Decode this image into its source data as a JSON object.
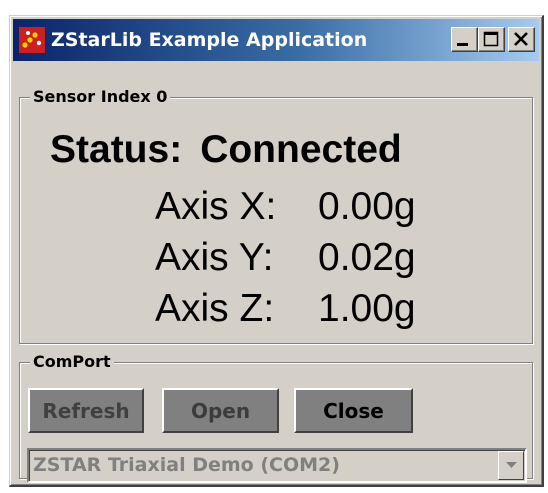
{
  "window": {
    "title": "ZStarLib Example Application",
    "icon": "zstar-app-icon",
    "controls": [
      "minimize-icon",
      "maximize-icon",
      "close-icon"
    ]
  },
  "sensor": {
    "group_label": "Sensor Index 0",
    "status_label": "Status:",
    "status_value": "Connected",
    "axes": [
      {
        "label": "Axis X:",
        "value": "0.00g"
      },
      {
        "label": "Axis Y:",
        "value": "0.02g"
      },
      {
        "label": "Axis Z:",
        "value": "1.00g"
      }
    ]
  },
  "comport": {
    "group_label": "ComPort",
    "refresh_label": "Refresh",
    "open_label": "Open",
    "close_label": "Close",
    "selected_port": "ZSTAR Triaxial Demo (COM2)"
  },
  "colors": {
    "title_gradient_start": "#0a246a",
    "title_gradient_end": "#a6caf0",
    "window_face": "#d4d0c8",
    "button_face": "#808080"
  }
}
